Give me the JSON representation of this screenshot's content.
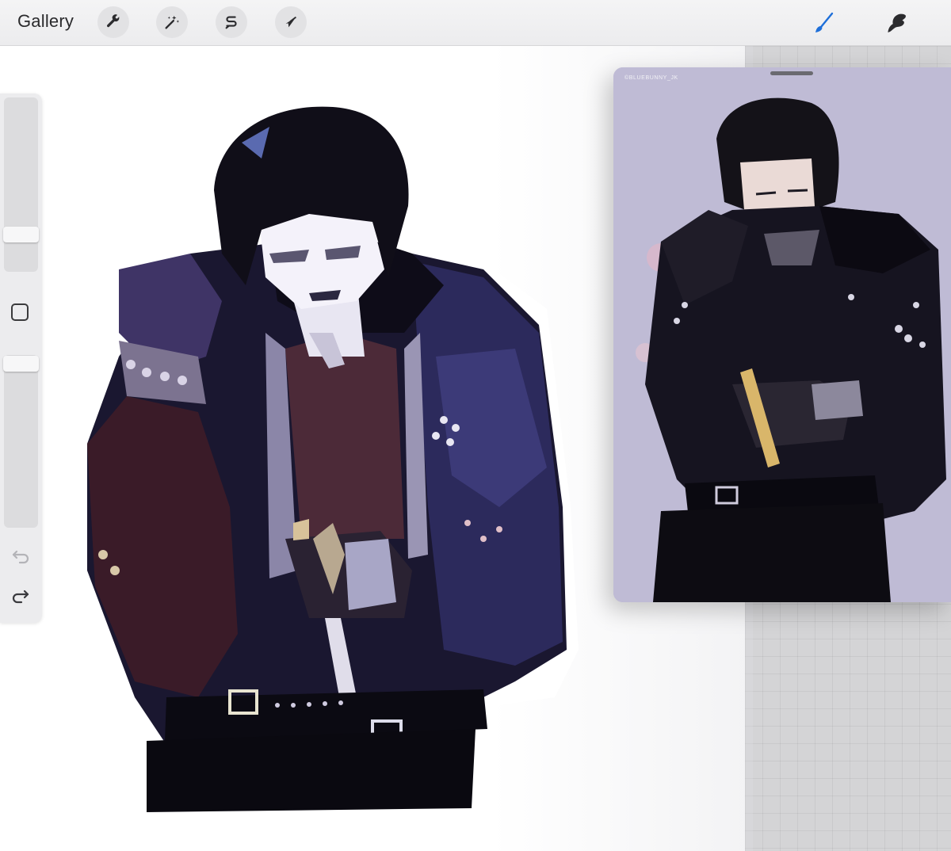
{
  "toolbar": {
    "gallery_label": "Gallery",
    "tools": [
      {
        "name": "actions",
        "icon": "wrench-icon"
      },
      {
        "name": "adjustments",
        "icon": "magic-wand-icon"
      },
      {
        "name": "selection",
        "icon": "selection-s-icon"
      },
      {
        "name": "transform",
        "icon": "arrow-cursor-icon"
      }
    ],
    "right_tools": [
      {
        "name": "brush",
        "icon": "brush-icon",
        "active": true
      },
      {
        "name": "smudge",
        "icon": "smudge-icon",
        "active": false
      }
    ]
  },
  "sidebar": {
    "brush_size_level": 0.28,
    "opacity_level": 0.05,
    "modify_button": "square-icon",
    "undo_icon": "undo-icon",
    "redo_icon": "redo-icon"
  },
  "reference": {
    "watermark": "©BLUEBUNNY_JK"
  },
  "colors": {
    "accent": "#1e6fd9",
    "toolbar_bg": "#ececee",
    "canvas_bg": "#ffffff",
    "panel_bg": "#d4d4d6"
  }
}
